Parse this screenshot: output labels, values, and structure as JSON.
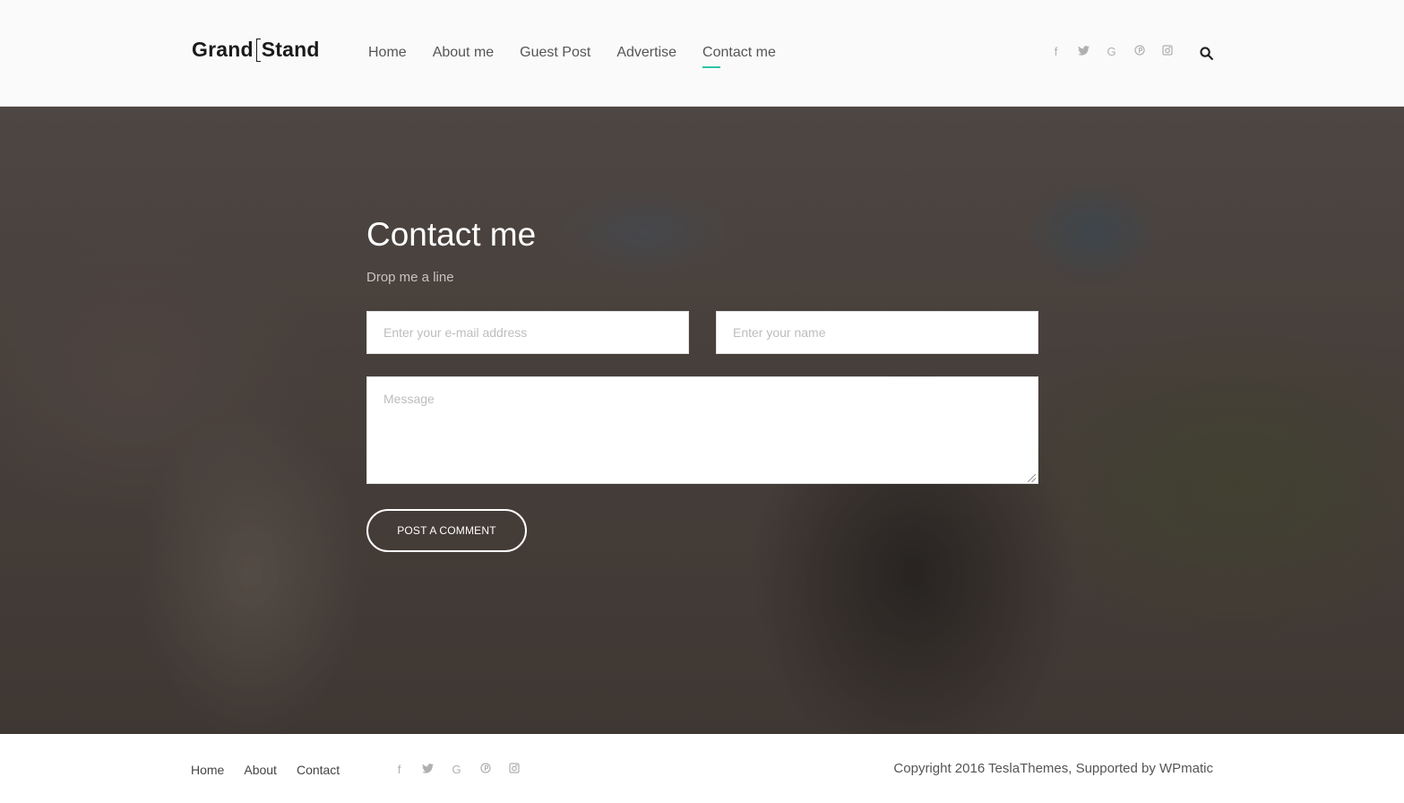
{
  "header": {
    "logo_left": "Grand",
    "logo_right": "Stand",
    "nav": [
      {
        "label": "Home"
      },
      {
        "label": "About me"
      },
      {
        "label": "Guest Post"
      },
      {
        "label": "Advertise"
      },
      {
        "label": "Contact me",
        "active": true
      }
    ],
    "social": [
      {
        "icon": "facebook-icon",
        "glyph": "f"
      },
      {
        "icon": "twitter-icon",
        "glyph": "🐦"
      },
      {
        "icon": "google-icon",
        "glyph": "G"
      },
      {
        "icon": "pinterest-icon",
        "glyph": "℗"
      },
      {
        "icon": "instagram-icon",
        "glyph": "◙"
      }
    ],
    "search_icon": "search-icon"
  },
  "contact": {
    "title": "Contact me",
    "subtitle": "Drop me a line",
    "email_placeholder": "Enter your e-mail address",
    "name_placeholder": "Enter your name",
    "message_placeholder": "Message",
    "submit_label": "POST A COMMENT"
  },
  "footer": {
    "nav": [
      {
        "label": "Home"
      },
      {
        "label": "About"
      },
      {
        "label": "Contact"
      }
    ],
    "copyright": "Copyright 2016 TeslaThemes, Supported by WPmatic"
  },
  "colors": {
    "accent": "#2ec4a6"
  }
}
